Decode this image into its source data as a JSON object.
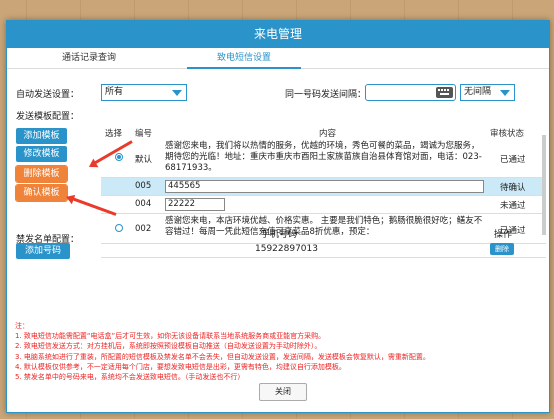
{
  "dialog": {
    "title": "来电管理",
    "tabs": [
      {
        "label": "通话记录查询",
        "active": false
      },
      {
        "label": "致电短信设置",
        "active": true
      }
    ]
  },
  "auto_send": {
    "label": "自动发送设置：",
    "value": "所有"
  },
  "interval": {
    "label": "同一号码发送间隔：",
    "value": "",
    "unit": "无间隔"
  },
  "template_section": {
    "label": "发送模板配置：",
    "buttons": {
      "add": "添加模板",
      "edit": "修改模板",
      "delete": "删除模板",
      "confirm": "确认模板"
    },
    "columns": [
      "选择",
      "编号",
      "内容",
      "审核状态"
    ],
    "rows": [
      {
        "selected": true,
        "code": "默认",
        "content": "感谢您来电，我们将以热情的服务，优越的环境，秀色可餐的菜品，竭诚为您服务，期待您的光临！地址：重庆市重庆市酉阳土家族苗族自治县体育馆对面，电话：023-68171933。",
        "status": "已通过"
      },
      {
        "selected": false,
        "code": "005",
        "content": "445565",
        "status": "待确认",
        "editing": true
      },
      {
        "selected": false,
        "code": "004",
        "content": "22222",
        "status": "未通过",
        "editing": true
      },
      {
        "selected": false,
        "code": "002",
        "content": "感谢您来电，本店环境优越、价格实惠。 主要是我们特色；鹅肠很脆很好吃；鳝友不容错过！每周一凭此短信充值可享菜品8折优惠，预定：",
        "status": "已通过"
      }
    ]
  },
  "blacklist": {
    "label": "禁发名单配置：",
    "add_button": "添加号码",
    "columns": [
      "手机号码",
      "操作"
    ],
    "rows": [
      {
        "phone": "15922897013",
        "action": "删除"
      }
    ]
  },
  "notes": {
    "title": "注：",
    "items": [
      "1. 致电短信功能需配置“电话盒”后才可生效，如你无该设备请联系当地系统服务商或亚能官方采购。",
      "2. 致电短信发送方式：对方挂机后，系统即按照预设模板自动推送（自动发送设置为手动时除外）。",
      "3. 电脑系统如进行了重装，所配置的短信模板及禁发名单不会丢失，但自动发送设置，发送间隔，发送模板会恢复默认，需重新配置。",
      "4. 默认模板仅供参考，不一定适用每个门店，要想发致电短信是出彩，更需有特色，均建议自行添加模板。",
      "5. 禁发名单中的号码来电，系统均不会发送致电短信。（手动发送也不行）"
    ]
  },
  "footer": {
    "close_label": "关闭"
  },
  "colors": {
    "primary": "#2a93c9",
    "orange": "#f0833a",
    "annotation_red": "#ea3a2a",
    "note_red": "#e22222"
  }
}
